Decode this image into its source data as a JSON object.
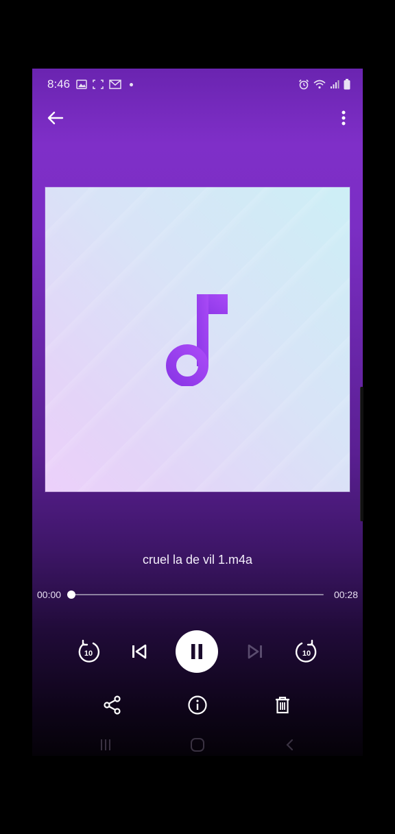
{
  "status": {
    "time": "8:46",
    "icons_left": [
      "photo-icon",
      "screenshot-icon",
      "gmail-icon",
      "dot-indicator"
    ],
    "icons_right": [
      "alarm-icon",
      "wifi-icon",
      "signal-icon",
      "battery-icon"
    ]
  },
  "toolbar": {
    "back_icon": "arrow-left-icon",
    "menu_icon": "more-vertical-icon"
  },
  "artwork": {
    "icon": "music-note-icon",
    "note_color": "#9b3df0"
  },
  "track": {
    "filename": "cruel la de vil 1.m4a",
    "elapsed": "00:00",
    "duration": "00:28",
    "progress": 0.0
  },
  "controls": {
    "rewind_icon": "replay-10-icon",
    "previous_icon": "skip-previous-icon",
    "play_pause_icon": "pause-icon",
    "next_icon": "skip-next-icon",
    "next_enabled": false,
    "forward_icon": "forward-10-icon",
    "rewind_seconds": "10",
    "forward_seconds": "10"
  },
  "actions": {
    "share_icon": "share-icon",
    "info_icon": "info-icon",
    "delete_icon": "trash-icon"
  },
  "system_nav": [
    "recents-icon",
    "home-icon",
    "back-icon"
  ],
  "colors": {
    "accent": "#9b3df0",
    "text": "#f3eefa"
  }
}
